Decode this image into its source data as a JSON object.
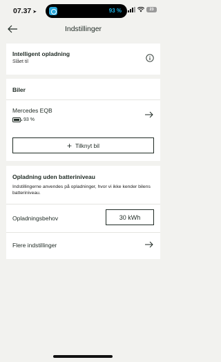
{
  "status_bar": {
    "time": "07.37",
    "island_percent": "93 %",
    "battery_level": "23"
  },
  "header": {
    "title": "Indstillinger"
  },
  "smart_charging": {
    "title": "Intelligent opladning",
    "status": "Slået til"
  },
  "cars": {
    "title": "Biler",
    "items": [
      {
        "name": "Mercedes EQB",
        "battery": "93 %"
      }
    ],
    "connect_label": "Tilknyt bil"
  },
  "no_battery_level": {
    "title": "Opladning uden batteriniveau",
    "description": "Indstillingerne anvendes på opladninger, hvor vi ikke kender bilens batteriniveau.",
    "need_label": "Opladningsbehov",
    "need_value": "30 kWh",
    "more_label": "Flere indstillinger"
  },
  "colors": {
    "background": "#f2f2ef",
    "card": "#ffffff",
    "text": "#1f2a24",
    "island_accent": "#1ab3e6"
  },
  "icons": [
    "back-arrow-icon",
    "info-icon",
    "arrow-right-icon",
    "battery-icon",
    "plus-icon"
  ]
}
